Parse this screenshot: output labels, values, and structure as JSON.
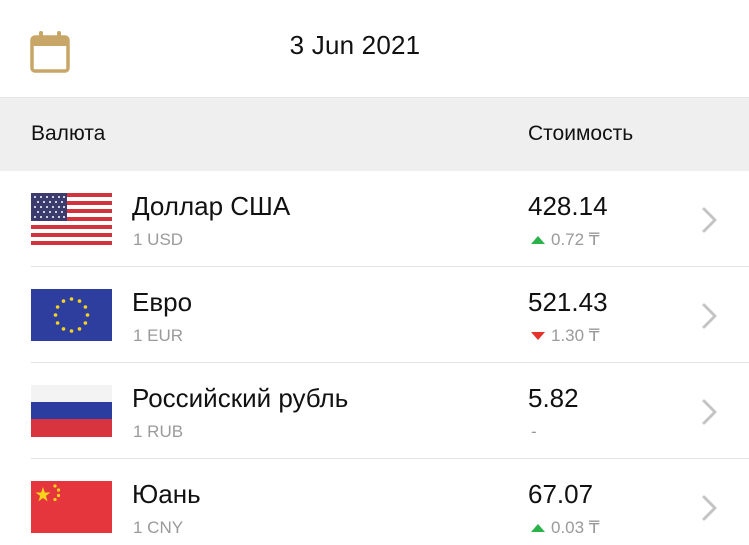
{
  "header": {
    "date": "3 Jun 2021",
    "calendar_icon": "calendar-icon",
    "accent_color": "#c8a668"
  },
  "columns": {
    "currency": "Валюта",
    "value": "Стоимость"
  },
  "rates": [
    {
      "name": "Доллар США",
      "unit": "1 USD",
      "value": "428.14",
      "trend": "up",
      "change": "0.72 ₸",
      "flag": "us-flag-icon"
    },
    {
      "name": "Евро",
      "unit": "1 EUR",
      "value": "521.43",
      "trend": "down",
      "change": "1.30 ₸",
      "flag": "eu-flag-icon"
    },
    {
      "name": "Российский рубль",
      "unit": "1 RUB",
      "value": "5.82",
      "trend": "none",
      "change": "-",
      "flag": "ru-flag-icon"
    },
    {
      "name": "Юань",
      "unit": "1 CNY",
      "value": "67.07",
      "trend": "up",
      "change": "0.03 ₸",
      "flag": "cn-flag-icon"
    }
  ],
  "colors": {
    "up": "#2bb24c",
    "down": "#e5322d",
    "muted": "#9a9a9a",
    "header_bg": "#efefef"
  }
}
